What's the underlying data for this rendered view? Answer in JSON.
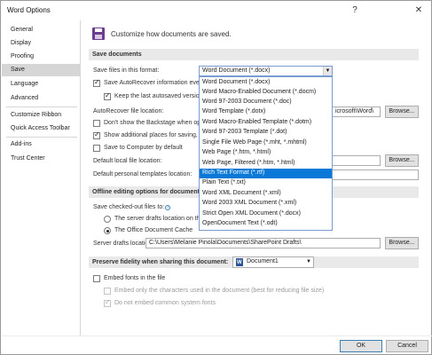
{
  "window": {
    "title": "Word Options",
    "help_glyph": "?",
    "close_glyph": "✕"
  },
  "sidebar": {
    "items": [
      {
        "label": "General"
      },
      {
        "label": "Display"
      },
      {
        "label": "Proofing"
      },
      {
        "label": "Save",
        "active": true
      },
      {
        "label": "Language"
      },
      {
        "label": "Advanced"
      },
      {
        "label": "Customize Ribbon"
      },
      {
        "label": "Quick Access Toolbar"
      },
      {
        "label": "Add-ins"
      },
      {
        "label": "Trust Center"
      }
    ]
  },
  "header": {
    "text": "Customize how documents are saved."
  },
  "save_documents": {
    "heading": "Save documents",
    "format_label": "Save files in this format:",
    "format_value": "Word Document (*.docx)",
    "autorecover_label": "Save AutoRecover information eve",
    "keep_last_label": "Keep the last autosaved version",
    "autorecover_location_label": "AutoRecover file location:",
    "autorecover_location_value": "icrosoft\\Word\\",
    "browse_label": "Browse...",
    "dont_show_backstage_label": "Don't show the Backstage when op",
    "show_additional_places_label": "Show additional places for saving,",
    "save_to_computer_label": "Save to Computer by default",
    "default_local_label": "Default local file location:",
    "default_templates_label": "Default personal templates location:"
  },
  "format_options": [
    "Word Document (*.docx)",
    "Word Macro-Enabled Document (*.docm)",
    "Word 97-2003 Document (*.doc)",
    "Word Template (*.dotx)",
    "Word Macro-Enabled Template (*.dotm)",
    "Word 97-2003 Template (*.dot)",
    "Single File Web Page (*.mht, *.mhtml)",
    "Web Page (*.htm, *.html)",
    "Web Page, Filtered (*.htm, *.html)",
    "Rich Text Format (*.rtf)",
    "Plain Text (*.txt)",
    "Word XML Document (*.xml)",
    "Word 2003 XML Document (*.xml)",
    "Strict Open XML Document (*.docx)",
    "OpenDocument Text (*.odt)"
  ],
  "format_highlighted_index": 9,
  "offline": {
    "heading": "Offline editing options for document",
    "checked_out_label": "Save checked-out files to:",
    "server_drafts_label": "The server drafts location on th",
    "office_cache_label": "The Office Document Cache",
    "server_drafts_location_label": "Server drafts location:",
    "server_drafts_location_value": "C:\\Users\\Melanie Pinola\\Documents\\SharePoint Drafts\\"
  },
  "fidelity": {
    "heading": "Preserve fidelity when sharing this document:",
    "document_value": "Document1",
    "embed_fonts_label": "Embed fonts in the file",
    "embed_only_used_label": "Embed only the characters used in the document (best for reducing file size)",
    "no_common_fonts_label": "Do not embed common system fonts"
  },
  "footer": {
    "ok_label": "OK",
    "cancel_label": "Cancel"
  },
  "colors": {
    "accent": "#0a78d7",
    "sidebar_active": "#d6d6d6",
    "section_bar": "#e9e9e9"
  }
}
